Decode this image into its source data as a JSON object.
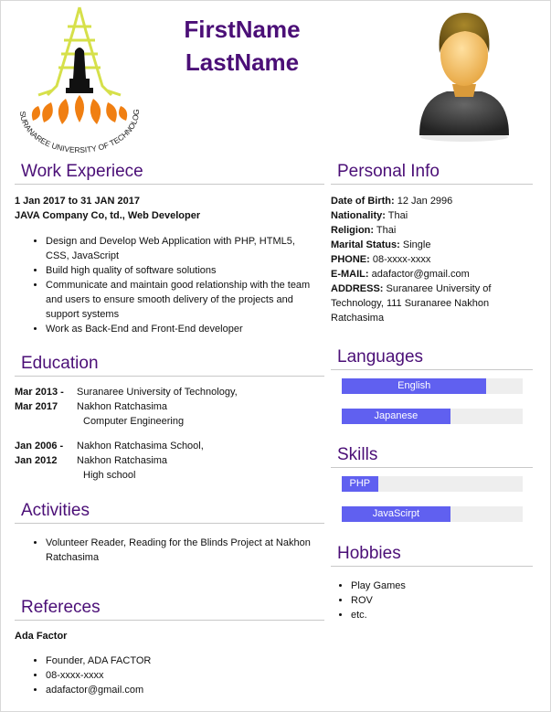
{
  "header": {
    "first_name": "FirstName",
    "last_name": "LastName",
    "logo_text": "SURANAREE UNIVERSITY OF TECHNOLOGY"
  },
  "work": {
    "title": "Work Experiece",
    "period": "1 Jan 2017 to 31 JAN 2017",
    "company": "JAVA Company Co, td., Web Developer",
    "items": [
      "Design and Develop Web Application with PHP, HTML5, CSS, JavaScript",
      "Build high quality of software solutions",
      "Communicate and maintain good relationship with the team and users to ensure smooth delivery of the projects and support systems",
      "Work as Back-End and Front-End developer"
    ]
  },
  "education": {
    "title": "Education",
    "entries": [
      {
        "date1": "Mar 2013 -",
        "date2": "Mar 2017",
        "school": "Suranaree University of Technology,",
        "city": "Nakhon Ratchasima",
        "detail": "Computer Engineering"
      },
      {
        "date1": "Jan 2006 -",
        "date2": "Jan 2012",
        "school": "Nakhon Ratchasima School,",
        "city": "Nakhon Ratchasima",
        "detail": "High school"
      }
    ]
  },
  "activities": {
    "title": "Activities",
    "items": [
      "Volunteer Reader, Reading for the Blinds Project at Nakhon Ratchasima"
    ]
  },
  "references": {
    "title": "Refereces",
    "name": "Ada Factor",
    "items": [
      "Founder, ADA FACTOR",
      "08-xxxx-xxxx",
      "adafactor@gmail.com"
    ]
  },
  "personal": {
    "title": "Personal Info",
    "dob_label": "Date of Birth:",
    "dob": "12 Jan 2996",
    "nationality_label": "Nationality:",
    "nationality": "Thai",
    "religion_label": "Religion:",
    "religion": "Thai",
    "marital_label": "Marital Status:",
    "marital": "Single",
    "phone_label": "PHONE:",
    "phone": "08-xxxx-xxxx",
    "email_label": "E-MAIL:",
    "email": "adafactor@gmail.com",
    "address_label": "ADDRESS:",
    "address": "Suranaree University of Technology, 111 Suranaree Nakhon Ratchasima"
  },
  "languages": {
    "title": "Languages",
    "items": [
      {
        "name": "English",
        "level": 0.8
      },
      {
        "name": "Japanese",
        "level": 0.6
      }
    ]
  },
  "skills": {
    "title": "Skills",
    "items": [
      {
        "name": "PHP",
        "level": 0.2
      },
      {
        "name": "JavaScirpt",
        "level": 0.6
      }
    ]
  },
  "hobbies": {
    "title": "Hobbies",
    "items": [
      "Play Games",
      "ROV",
      "etc."
    ]
  },
  "colors": {
    "accent": "#4b0f77",
    "bar": "#6060f0",
    "bar_track": "#eeeeee"
  }
}
